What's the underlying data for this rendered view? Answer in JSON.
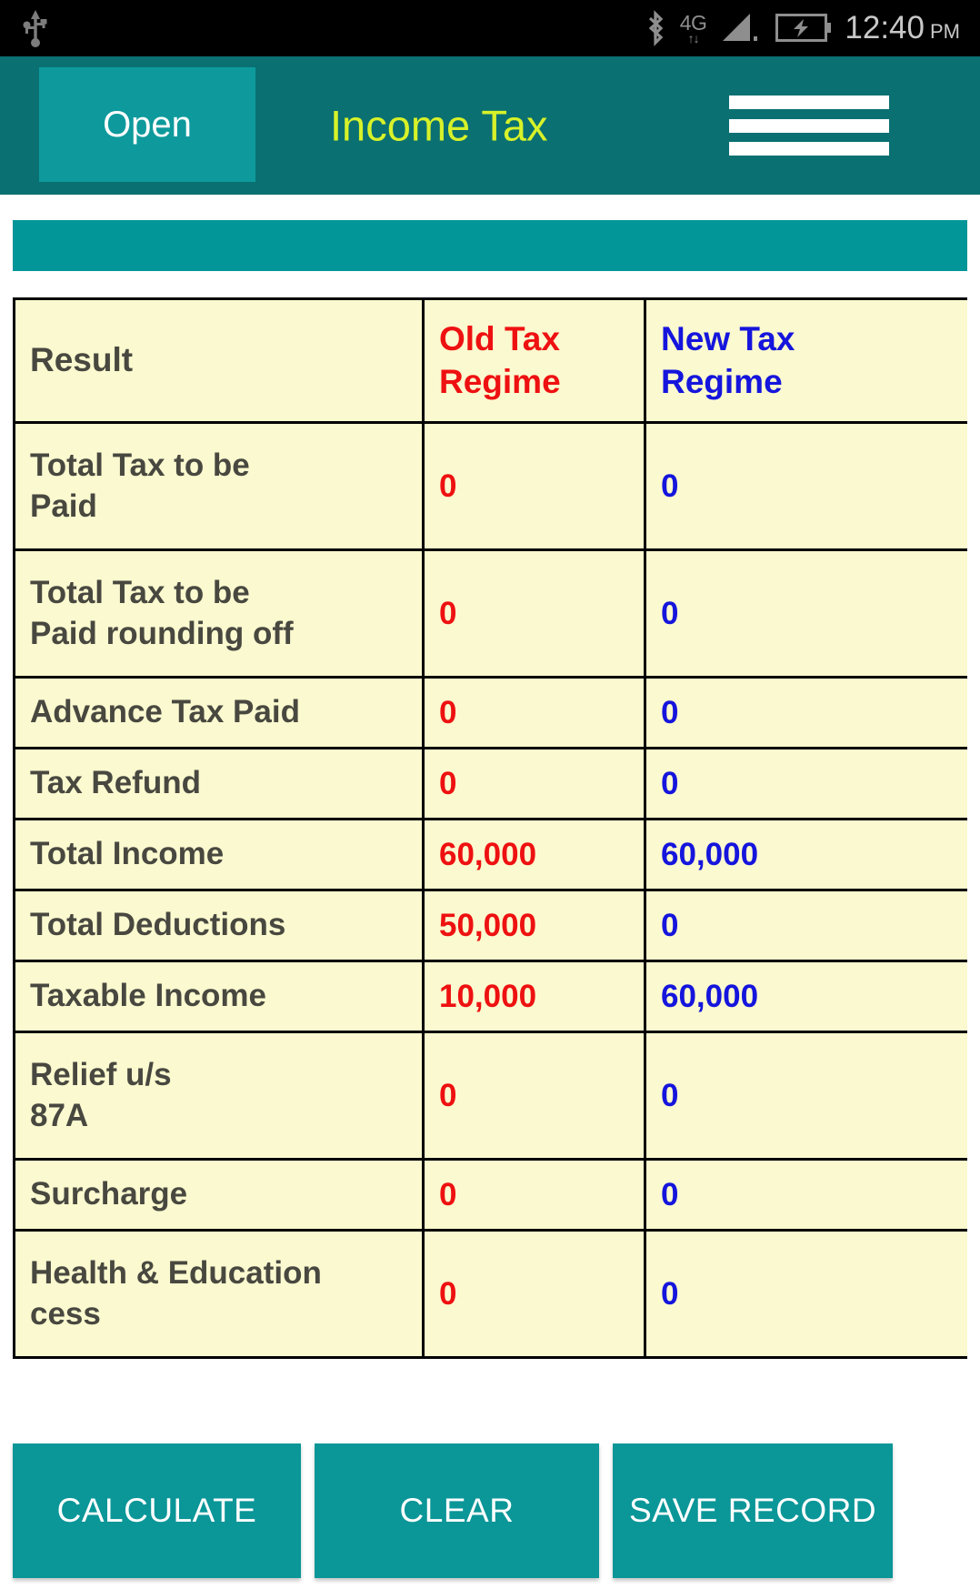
{
  "status_bar": {
    "usb_icon": "usb-icon",
    "bluetooth_icon": "bluetooth-icon",
    "network_type": "4G",
    "network_arrows": "↑↓",
    "signal_icon": "signal-strength-icon",
    "battery_icon": "battery-charging-icon",
    "time": "12:40",
    "ampm": "PM"
  },
  "app_bar": {
    "open_label": "Open",
    "title": "Income Tax",
    "menu_icon": "hamburger-menu-icon"
  },
  "colors": {
    "app_bar_teal": "#0a7072",
    "accent_teal": "#029698",
    "title_yellow": "#d7f229",
    "old_regime_red": "#ee1111",
    "new_regime_blue": "#1515dd",
    "table_bg": "#fbf9cf",
    "label_gray": "#484840"
  },
  "table": {
    "headers": {
      "label": "Result",
      "old": "Old Tax\nRegime",
      "old_line1": "Old Tax",
      "old_line2": "Regime",
      "new_line1": "New Tax",
      "new_line2": "Regime"
    },
    "rows": [
      {
        "label": "Total Tax to be Paid",
        "label_line1": "Total Tax to be",
        "label_line2": "Paid",
        "old": "0",
        "new": "0",
        "tall": true
      },
      {
        "label": "Total Tax to be Paid rounding off",
        "label_line1": "Total Tax to be",
        "label_line2": "Paid rounding off",
        "old": "0",
        "new": "0",
        "tall": true
      },
      {
        "label": "Advance Tax Paid",
        "label_line1": "Advance Tax Paid",
        "label_line2": "",
        "old": "0",
        "new": "0",
        "tall": false
      },
      {
        "label": "Tax Refund",
        "label_line1": "Tax Refund",
        "label_line2": "",
        "old": "0",
        "new": "0",
        "tall": false
      },
      {
        "label": "Total Income",
        "label_line1": "Total Income",
        "label_line2": "",
        "old": "60,000",
        "new": "60,000",
        "tall": false
      },
      {
        "label": "Total Deductions",
        "label_line1": "Total Deductions",
        "label_line2": "",
        "old": "50,000",
        "new": "0",
        "tall": false
      },
      {
        "label": "Taxable Income",
        "label_line1": "Taxable Income",
        "label_line2": "",
        "old": "10,000",
        "new": "60,000",
        "tall": false
      },
      {
        "label": "Relief u/s 87A",
        "label_line1": "Relief u/s",
        "label_line2": "87A",
        "old": "0",
        "new": "0",
        "tall": true
      },
      {
        "label": "Surcharge",
        "label_line1": "Surcharge",
        "label_line2": "",
        "old": "0",
        "new": "0",
        "tall": false
      },
      {
        "label": "Health & Education cess",
        "label_line1": "Health & Education",
        "label_line2": "cess",
        "old": "0",
        "new": "0",
        "tall": true
      }
    ]
  },
  "actions": {
    "calculate": "CALCULATE",
    "clear": "CLEAR",
    "save_record": "SAVE RECORD"
  }
}
